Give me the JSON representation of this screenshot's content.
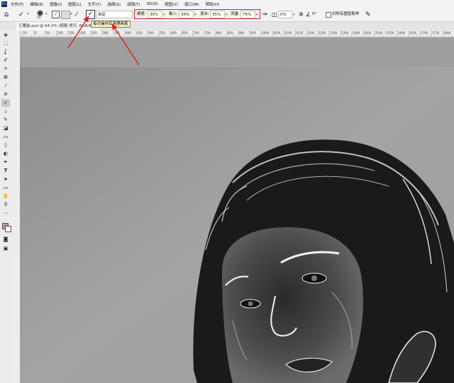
{
  "app": {
    "logo_text": "Ps"
  },
  "menu": [
    "文件(F)",
    "编辑(E)",
    "图像(I)",
    "图层(L)",
    "文字(Y)",
    "选择(S)",
    "滤镜(T)",
    "3D(D)",
    "视图(V)",
    "窗口(W)",
    "帮助(H)"
  ],
  "options": {
    "brush_size": "20",
    "range_value": "自定",
    "strength": {
      "label": "硬度:",
      "value": "35%"
    },
    "crop": {
      "label": "截入:",
      "value": "35%"
    },
    "blend": {
      "label": "混合:",
      "value": "35%"
    },
    "flow": {
      "label": "流量:",
      "value": "75%"
    },
    "smoothing": "0%",
    "angle": "0°",
    "sample_all_label": "对所有图层取样",
    "tooltip": "每次操作后清理画笔"
  },
  "document": {
    "tab_title": "王雁晨.psd @ 64.2% (粗糙 拷贝, RGB/8) *"
  },
  "ruler": {
    "ticks": [
      "50",
      "0",
      "50",
      "100",
      "150",
      "200",
      "250",
      "300",
      "350",
      "400",
      "450",
      "500",
      "550",
      "600",
      "650",
      "700",
      "750",
      "800",
      "850",
      "900",
      "950",
      "1000",
      "1050",
      "1100",
      "1150",
      "1200",
      "1250",
      "1300",
      "1350",
      "1400",
      "1450",
      "1500",
      "1550",
      "1600",
      "1650",
      "1700",
      "1750",
      "1800"
    ]
  },
  "tools": [
    "move-tool",
    "marquee-tool",
    "lasso-tool",
    "quick-select-tool",
    "crop-tool",
    "frame-tool",
    "eyedropper-tool",
    "healing-brush-tool",
    "brush-tool",
    "clone-stamp-tool",
    "history-brush-tool",
    "eraser-tool",
    "gradient-tool",
    "blur-tool",
    "dodge-tool",
    "pen-tool",
    "type-tool",
    "path-select-tool",
    "rectangle-tool",
    "hand-tool",
    "zoom-tool",
    "more-tools"
  ],
  "colors": {
    "highlight": "#e02020",
    "foreground": "#b89a8a",
    "background": "#ffffff"
  }
}
